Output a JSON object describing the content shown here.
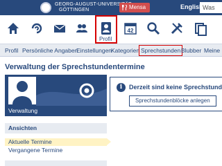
{
  "header": {
    "university_line1": "GEORG-AUGUST-UNIVERSITÄT",
    "university_line2": "GÖTTINGEN",
    "mensa_label": "Mensa",
    "language": "English",
    "search_placeholder": "Was"
  },
  "icon_nav": {
    "items": [
      {
        "icon": "home-icon"
      },
      {
        "icon": "activity-icon"
      },
      {
        "icon": "mail-icon"
      },
      {
        "icon": "community-icon"
      },
      {
        "icon": "profile-icon",
        "label": "Profil",
        "active": true
      },
      {
        "icon": "calendar-icon",
        "day": "42"
      },
      {
        "icon": "search-icon"
      },
      {
        "icon": "tools-icon"
      },
      {
        "icon": "files-icon"
      }
    ]
  },
  "subnav": {
    "items": [
      "Profil",
      "Persönliche Angaben",
      "Einstellungen",
      "Kategorien",
      "Sprechstunden",
      "Blubber",
      "Meine N"
    ],
    "active": "Sprechstunden"
  },
  "page_title": "Verwaltung der Sprechstundentermine",
  "sidebar": {
    "active_item": "Verwaltung",
    "group_title": "Ansichten",
    "items": [
      "Aktuelle Termine",
      "Vergangene Termine"
    ],
    "selected": "Aktuelle Termine"
  },
  "message": {
    "text": "Derzeit sind keine Sprechstundenter",
    "button_label": "Sprechstundenblöcke anlegen"
  },
  "colors": {
    "brand_blue": "#28497c",
    "highlight_red": "#d60000",
    "mensa_red": "#d14e4e",
    "selected_yellow": "#fff3c4"
  }
}
